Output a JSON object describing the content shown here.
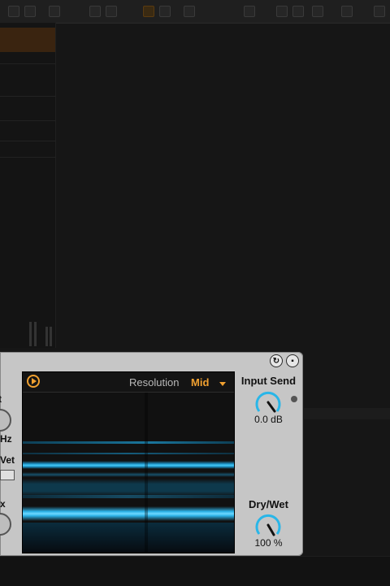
{
  "device": {
    "display": {
      "resolution_label": "Resolution",
      "resolution_value": "Mid",
      "play_icon": "play-icon"
    },
    "left_strip": {
      "label_1": "t",
      "label_2": "Hz",
      "label_3": "Vet",
      "label_4": "x"
    },
    "input_send": {
      "label": "Input Send",
      "value": "0.0 dB"
    },
    "dry_wet": {
      "label": "Dry/Wet",
      "value": "100 %"
    },
    "header_icons": [
      "hot-swap-icon",
      "save-preset-icon"
    ]
  },
  "colors": {
    "accent": "#f0a030",
    "knob_arc": "#29b6e8",
    "device_bg": "#c6c6c6",
    "background": "#161616"
  }
}
